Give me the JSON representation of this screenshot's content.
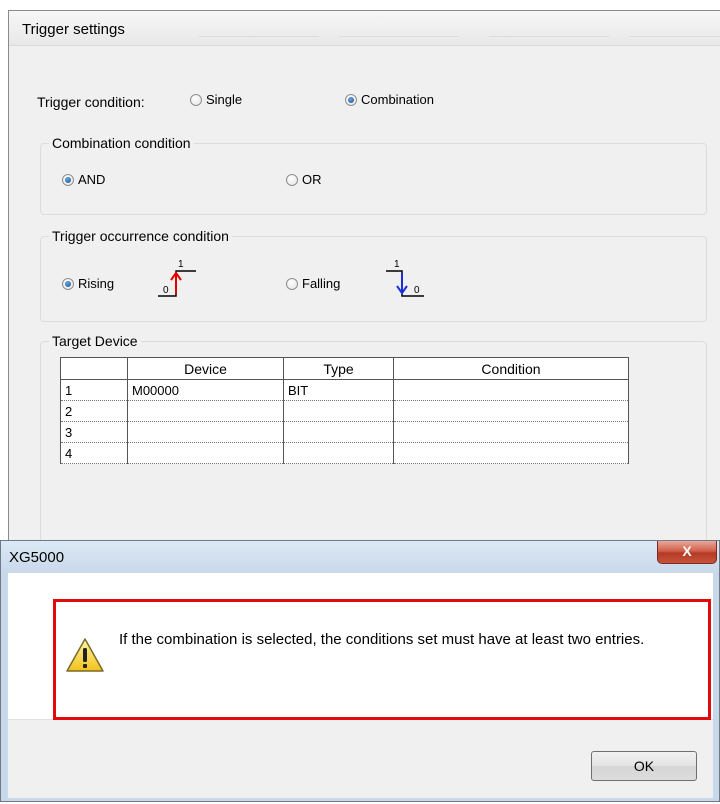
{
  "trigger_window": {
    "title": "Trigger settings",
    "trigger_condition": {
      "label": "Trigger condition:",
      "options": [
        "Single",
        "Combination"
      ],
      "selected": "Combination"
    },
    "combination_condition": {
      "legend": "Combination condition",
      "options": [
        "AND",
        "OR"
      ],
      "selected": "AND"
    },
    "occurrence_condition": {
      "legend": "Trigger occurrence condition",
      "options": [
        "Rising",
        "Falling"
      ],
      "selected": "Rising",
      "diagram_high": "1",
      "diagram_low": "0"
    },
    "target_device": {
      "legend": "Target Device",
      "columns": [
        "Device",
        "Type",
        "Condition"
      ],
      "rows": [
        {
          "num": "1",
          "device": "M00000",
          "type": "BIT",
          "condition": ""
        },
        {
          "num": "2",
          "device": "",
          "type": "",
          "condition": ""
        },
        {
          "num": "3",
          "device": "",
          "type": "",
          "condition": ""
        },
        {
          "num": "4",
          "device": "",
          "type": "",
          "condition": ""
        }
      ]
    }
  },
  "dialog": {
    "title": "XG5000",
    "close_label": "X",
    "message": "If the combination is selected, the conditions set must have at least two entries.",
    "ok_label": "OK",
    "icon": "warning-icon",
    "highlight_color": "#e20b0b"
  }
}
